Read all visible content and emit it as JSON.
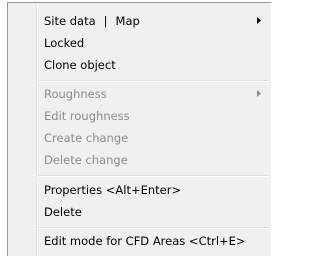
{
  "menu": {
    "site_data_label": "Site data",
    "pipe": "|",
    "map_label": "Map",
    "locked_label": "Locked",
    "clone_label": "Clone object",
    "roughness_label": "Roughness",
    "edit_roughness_label": "Edit roughness",
    "create_change_label": "Create change",
    "delete_change_label": "Delete change",
    "properties_label": "Properties <Alt+Enter>",
    "delete_label": "Delete",
    "edit_mode_label": "Edit mode for CFD Areas <Ctrl+E>"
  },
  "icons": {
    "submenu_arrow": "chevron-right-icon"
  },
  "colors": {
    "menu_background": "#f0f0f0",
    "text": "#000000",
    "disabled_text": "#8c8c8c"
  }
}
